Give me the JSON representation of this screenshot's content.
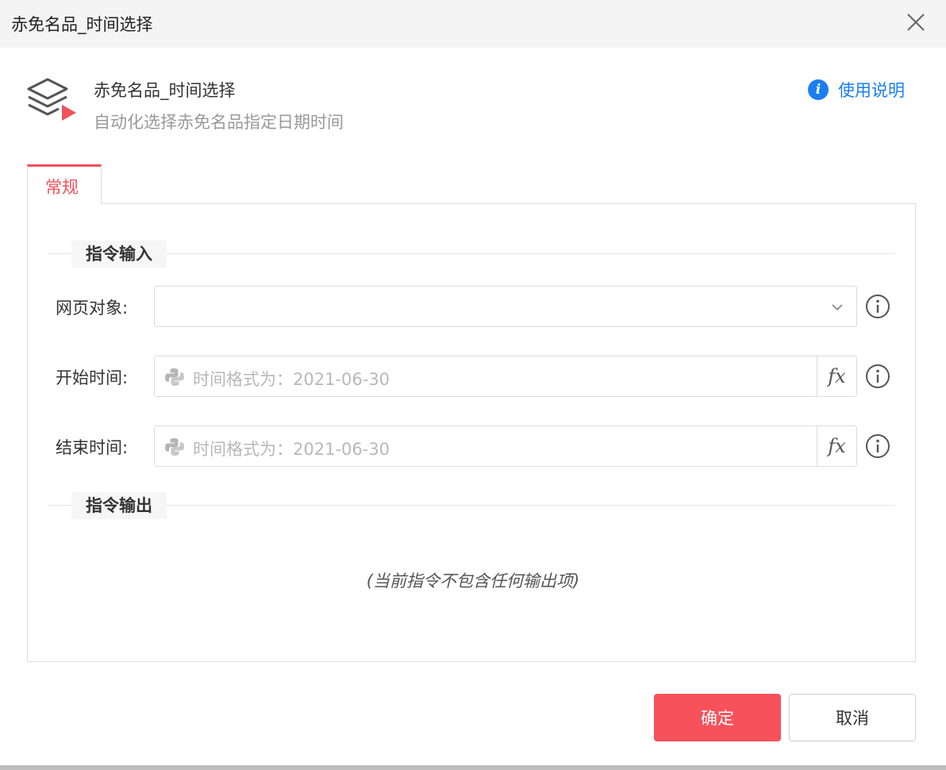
{
  "window": {
    "title": "赤免名品_时间选择"
  },
  "header": {
    "title": "赤免名品_时间选择",
    "subtitle": "自动化选择赤免名品指定日期时间",
    "help_label": "使用说明",
    "icon": "layers-play-icon"
  },
  "tabs": [
    {
      "label": "常规",
      "active": true
    }
  ],
  "sections": {
    "input": "指令输入",
    "output": "指令输出",
    "output_empty": "(当前指令不包含任何输出项)"
  },
  "fields": {
    "web_object": {
      "label": "网页对象:",
      "value": ""
    },
    "start_time": {
      "label": "开始时间:",
      "placeholder": "时间格式为：2021-06-30",
      "fx": "fx"
    },
    "end_time": {
      "label": "结束时间:",
      "placeholder": "时间格式为：2021-06-30",
      "fx": "fx"
    }
  },
  "buttons": {
    "confirm": "确定",
    "cancel": "取消"
  },
  "colors": {
    "accent": "#f7515b",
    "link": "#1a7ef0"
  }
}
